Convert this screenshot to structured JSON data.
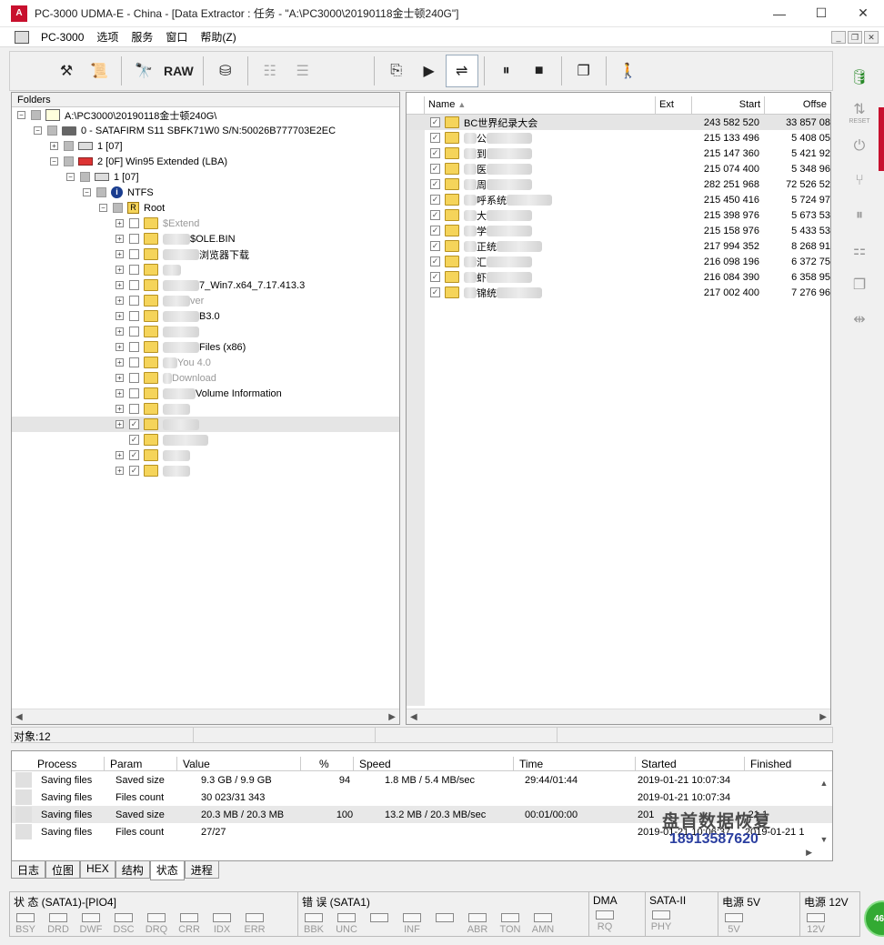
{
  "window": {
    "title": "PC-3000 UDMA-E - China - [Data Extractor : 任务 - \"A:\\PC3000\\20190118金士顿240G\"]",
    "minimize": "—",
    "maximize": "☐",
    "close": "✕"
  },
  "menu": {
    "items": [
      "PC-3000",
      "选项",
      "服务",
      "窗口",
      "帮助(Z)"
    ]
  },
  "toolbar": {
    "raw_label": "RAW"
  },
  "folders_panel": {
    "header": "Folders",
    "tree": [
      {
        "indent": 0,
        "exp": "⊟",
        "chk": "partial",
        "icon": "pc",
        "label": "A:\\PC3000\\20190118金士顿240G\\"
      },
      {
        "indent": 1,
        "exp": "⊟",
        "chk": "partial",
        "icon": "disk",
        "label": "0 - SATAFIRM   S11 SBFK71W0 S/N:50026B777703E2EC"
      },
      {
        "indent": 2,
        "exp": "⊞",
        "chk": "partial",
        "icon": "drive",
        "label": "1 [07]"
      },
      {
        "indent": 2,
        "exp": "⊟",
        "chk": "partial",
        "icon": "ext",
        "label": "2 [0F] Win95 Extended  (LBA)"
      },
      {
        "indent": 3,
        "exp": "⊟",
        "chk": "partial",
        "icon": "drive",
        "label": "1 [07]"
      },
      {
        "indent": 4,
        "exp": "⊟",
        "chk": "partial",
        "icon": "info",
        "label": "NTFS"
      },
      {
        "indent": 5,
        "exp": "⊟",
        "chk": "partial",
        "icon": "root",
        "label": "Root"
      },
      {
        "indent": 6,
        "exp": "⊞",
        "chk": "",
        "icon": "folder",
        "label": "$Extend",
        "faded": true
      },
      {
        "indent": 6,
        "exp": "⊞",
        "chk": "",
        "icon": "folder",
        "label": "$OLE.BIN",
        "blurpre": 30
      },
      {
        "indent": 6,
        "exp": "⊞",
        "chk": "",
        "icon": "folder",
        "label": "浏览器下载",
        "blurpre": 40
      },
      {
        "indent": 6,
        "exp": "⊞",
        "chk": "",
        "icon": "folder",
        "label": "",
        "blurpre": 20
      },
      {
        "indent": 6,
        "exp": "⊞",
        "chk": "",
        "icon": "folder",
        "label": "7_Win7.x64_7.17.413.3",
        "blurpre": 40
      },
      {
        "indent": 6,
        "exp": "⊞",
        "chk": "",
        "icon": "folder",
        "label": "ver",
        "blurpre": 30,
        "faded": true
      },
      {
        "indent": 6,
        "exp": "⊞",
        "chk": "",
        "icon": "folder",
        "label": "B3.0",
        "blurpre": 40
      },
      {
        "indent": 6,
        "exp": "⊞",
        "chk": "",
        "icon": "folder",
        "label": "",
        "blurpre": 40
      },
      {
        "indent": 6,
        "exp": "⊞",
        "chk": "",
        "icon": "folder",
        "label": "Files (x86)",
        "blurpre": 40
      },
      {
        "indent": 6,
        "exp": "⊞",
        "chk": "",
        "icon": "folder",
        "label": "You 4.0",
        "blurpre": 16,
        "faded": true
      },
      {
        "indent": 6,
        "exp": "⊞",
        "chk": "",
        "icon": "folder",
        "label": "Download",
        "blurpre": 10,
        "faded": true
      },
      {
        "indent": 6,
        "exp": "⊞",
        "chk": "",
        "icon": "folder",
        "label": "Volume Information",
        "blurpre": 36
      },
      {
        "indent": 6,
        "exp": "⊞",
        "chk": "",
        "icon": "folder",
        "label": "",
        "blurpre": 30
      },
      {
        "indent": 6,
        "exp": "⊞",
        "chk": "✓",
        "icon": "folder",
        "label": "",
        "blurpre": 40,
        "selected": true
      },
      {
        "indent": 6,
        "exp": "",
        "chk": "✓",
        "icon": "folder",
        "label": "",
        "blurpre": 50
      },
      {
        "indent": 6,
        "exp": "⊞",
        "chk": "✓",
        "icon": "folder",
        "label": "",
        "blurpre": 30
      },
      {
        "indent": 6,
        "exp": "⊞",
        "chk": "✓",
        "icon": "folder",
        "label": "",
        "blurpre": 30
      }
    ]
  },
  "files_panel": {
    "columns": [
      "Name",
      "Ext",
      "Start",
      "Offse"
    ],
    "rows": [
      {
        "name": "BC世界纪录大会",
        "start": "243 582 520",
        "offset": "33 857 08",
        "blur": false
      },
      {
        "name": "公",
        "start": "215 133 496",
        "offset": "5 408 05",
        "blur": true
      },
      {
        "name": "到",
        "start": "215 147 360",
        "offset": "5 421 92",
        "blur": true
      },
      {
        "name": "医",
        "start": "215 074 400",
        "offset": "5 348 96",
        "blur": true
      },
      {
        "name": "周",
        "start": "282 251 968",
        "offset": "72 526 52",
        "blur": true
      },
      {
        "name": "呼系统",
        "start": "215 450 416",
        "offset": "5 724 97",
        "blur": true
      },
      {
        "name": "大",
        "start": "215 398 976",
        "offset": "5 673 53",
        "blur": true
      },
      {
        "name": "学",
        "start": "215 158 976",
        "offset": "5 433 53",
        "blur": true
      },
      {
        "name": "正统",
        "start": "217 994 352",
        "offset": "8 268 91",
        "blur": true
      },
      {
        "name": "汇",
        "start": "216 098 196",
        "offset": "6 372 75",
        "blur": true
      },
      {
        "name": "虾",
        "start": "216 084 390",
        "offset": "6 358 95",
        "blur": true
      },
      {
        "name": "锦统",
        "start": "217 002 400",
        "offset": "7 276 96",
        "blur": true
      }
    ]
  },
  "statusbar": {
    "objects": "对象:12"
  },
  "process_panel": {
    "columns": [
      "Process",
      "Param",
      "Value",
      "%",
      "Speed",
      "Time",
      "Started",
      "Finished"
    ],
    "rows": [
      [
        "Saving files",
        "Saved size",
        "9.3 GB / 9.9 GB",
        "94",
        "1.8 MB / 5.4 MB/sec",
        "29:44/01:44",
        "2019-01-21 10:07:34",
        ""
      ],
      [
        "Saving files",
        "Files count",
        "30 023/31 343",
        "",
        "",
        "",
        "2019-01-21 10:07:34",
        ""
      ],
      [
        "Saving files",
        "Saved size",
        "20.3 MB / 20.3 MB",
        "100",
        "13.2 MB / 20.3 MB/sec",
        "00:01/00:00",
        "201",
        "-21 1"
      ],
      [
        "Saving files",
        "Files count",
        "27/27",
        "",
        "",
        "",
        "2019-01-21 10:06:37",
        "2019-01-21 1"
      ]
    ]
  },
  "watermark": {
    "line1": "盘首数据恢复",
    "line2": "18913587620"
  },
  "tabs": [
    "日志",
    "位图",
    "HEX",
    "结构",
    "状态",
    "进程"
  ],
  "indicators": {
    "groups": [
      {
        "title": "状 态 (SATA1)-[PIO4]",
        "items": [
          "BSY",
          "DRD",
          "DWF",
          "DSC",
          "DRQ",
          "CRR",
          "IDX",
          "ERR"
        ]
      },
      {
        "title": "错 误 (SATA1)",
        "items": [
          "BBK",
          "UNC",
          "",
          "INF",
          "",
          "ABR",
          "TON",
          "AMN"
        ]
      },
      {
        "title": "DMA",
        "items": [
          "RQ"
        ]
      },
      {
        "title": "SATA-II",
        "items": [
          "PHY"
        ]
      },
      {
        "title": "电源 5V",
        "items": [
          "5V"
        ]
      },
      {
        "title": "电源 12V",
        "items": [
          "12V"
        ]
      }
    ]
  },
  "side_toolbar": {
    "reset_label": "RESET"
  },
  "badge": "46"
}
